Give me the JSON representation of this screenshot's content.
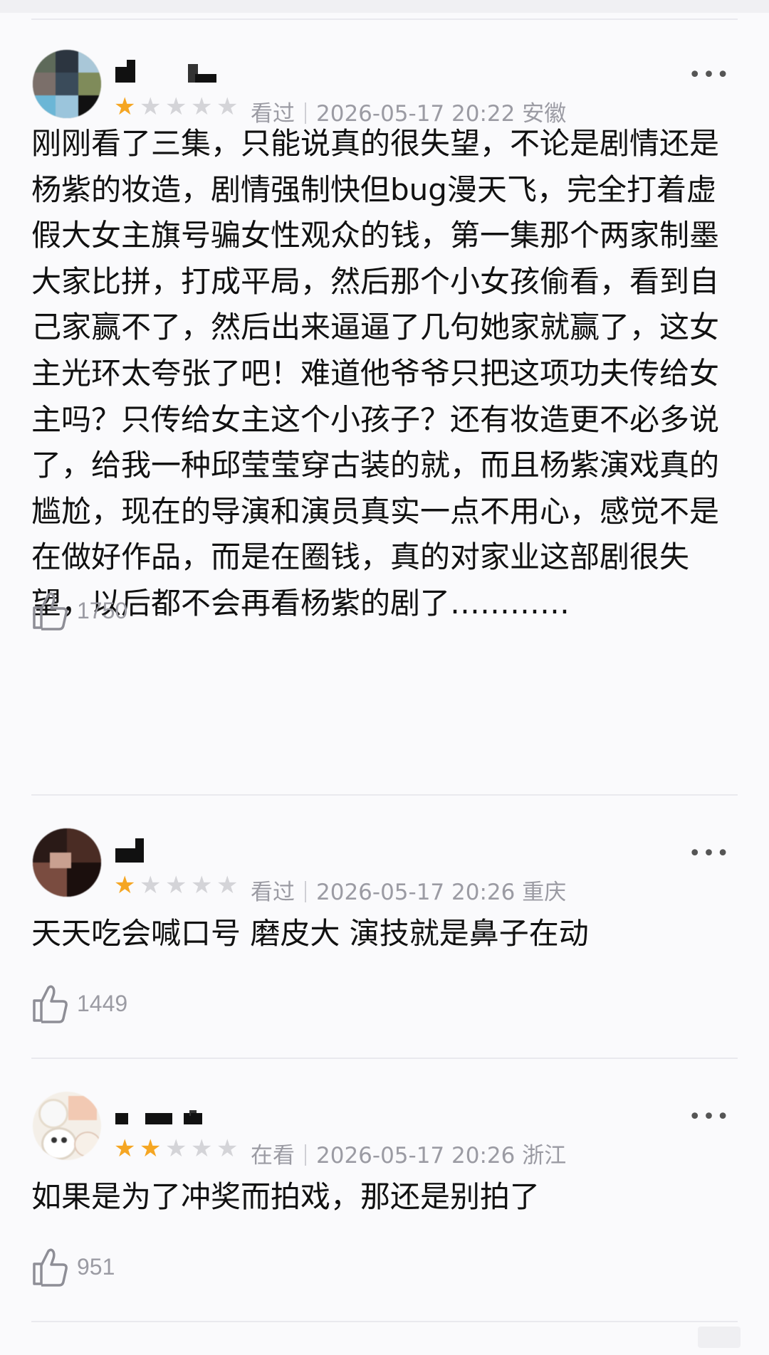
{
  "colors": {
    "star_on": "#f5a623",
    "star_off": "#d4d4d8",
    "meta": "#9b9ba3",
    "text": "#111111"
  },
  "icons": {
    "more": "more-dots-icon",
    "like": "thumbs-up-icon",
    "star": "star-icon"
  },
  "more_label": "•••",
  "reviews": [
    {
      "rating": 1,
      "status": "看过",
      "datetime": "2026-05-17 20:22",
      "location": "安徽",
      "text": "刚刚看了三集，只能说真的很失望，不论是剧情还是杨紫的妆造，剧情强制快但bug漫天飞，完全打着虚假大女主旗号骗女性观众的钱，第一集那个两家制墨大家比拼，打成平局，然后那个小女孩偷看，看到自己家赢不了，然后出来逼逼了几句她家就赢了，这女主光环太夸张了吧！难道他爷爷只把这项功夫传给女主吗？只传给女主这个小孩子？还有妆造更不必多说了，给我一种邱莹莹穿古装的就，而且杨紫演戏真的尴尬，现在的导演和演员真实一点不用心，感觉不是在做好作品，而是在圈钱，真的对家业这部剧很失望，以后都不会再看杨紫的剧了…………",
      "likes": "1750"
    },
    {
      "rating": 1,
      "status": "看过",
      "datetime": "2026-05-17 20:26",
      "location": "重庆",
      "text": "天天吃会喊口号 磨皮大 演技就是鼻子在动",
      "likes": "1449"
    },
    {
      "rating": 2,
      "status": "在看",
      "datetime": "2026-05-17 20:26",
      "location": "浙江",
      "text": "如果是为了冲奖而拍戏，那还是别拍了",
      "likes": "951"
    }
  ]
}
